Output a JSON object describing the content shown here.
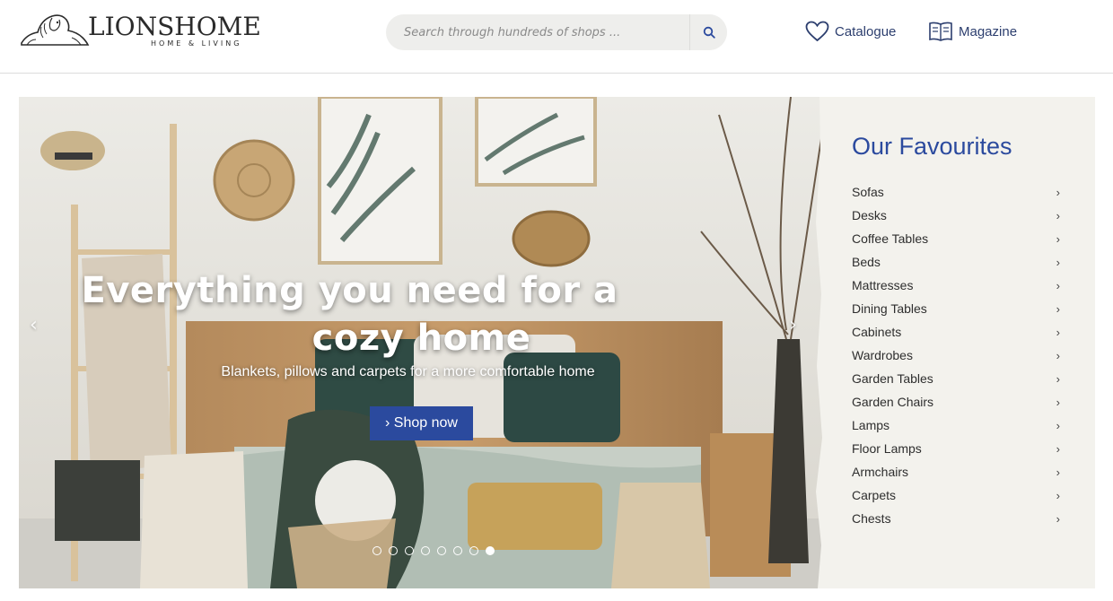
{
  "header": {
    "logo_name": "LIONSHOME",
    "logo_sub": "HOME & LIVING",
    "search_placeholder": "Search through hundreds of shops ...",
    "nav": [
      {
        "label": "Catalogue",
        "icon": "heart-icon"
      },
      {
        "label": "Magazine",
        "icon": "book-icon"
      }
    ]
  },
  "hero": {
    "title_line1": "Everything you need for a",
    "title_line2": "cozy home",
    "subtitle": "Blankets, pillows and carpets for a more comfortable home",
    "cta": "› Shop now",
    "prev": "‹",
    "next": "›",
    "slides_total": 8,
    "active_slide": 8
  },
  "favourites": {
    "title": "Our Favourites",
    "chevron": "›",
    "items": [
      "Sofas",
      "Desks",
      "Coffee Tables",
      "Beds",
      "Mattresses",
      "Dining Tables",
      "Cabinets",
      "Wardrobes",
      "Garden Tables",
      "Garden Chairs",
      "Lamps",
      "Floor Lamps",
      "Armchairs",
      "Carpets",
      "Chests"
    ]
  },
  "colors": {
    "brand_blue": "#2b4a9e",
    "nav_text": "#2c3e6e",
    "sidebar_bg": "#f3f2ed"
  }
}
